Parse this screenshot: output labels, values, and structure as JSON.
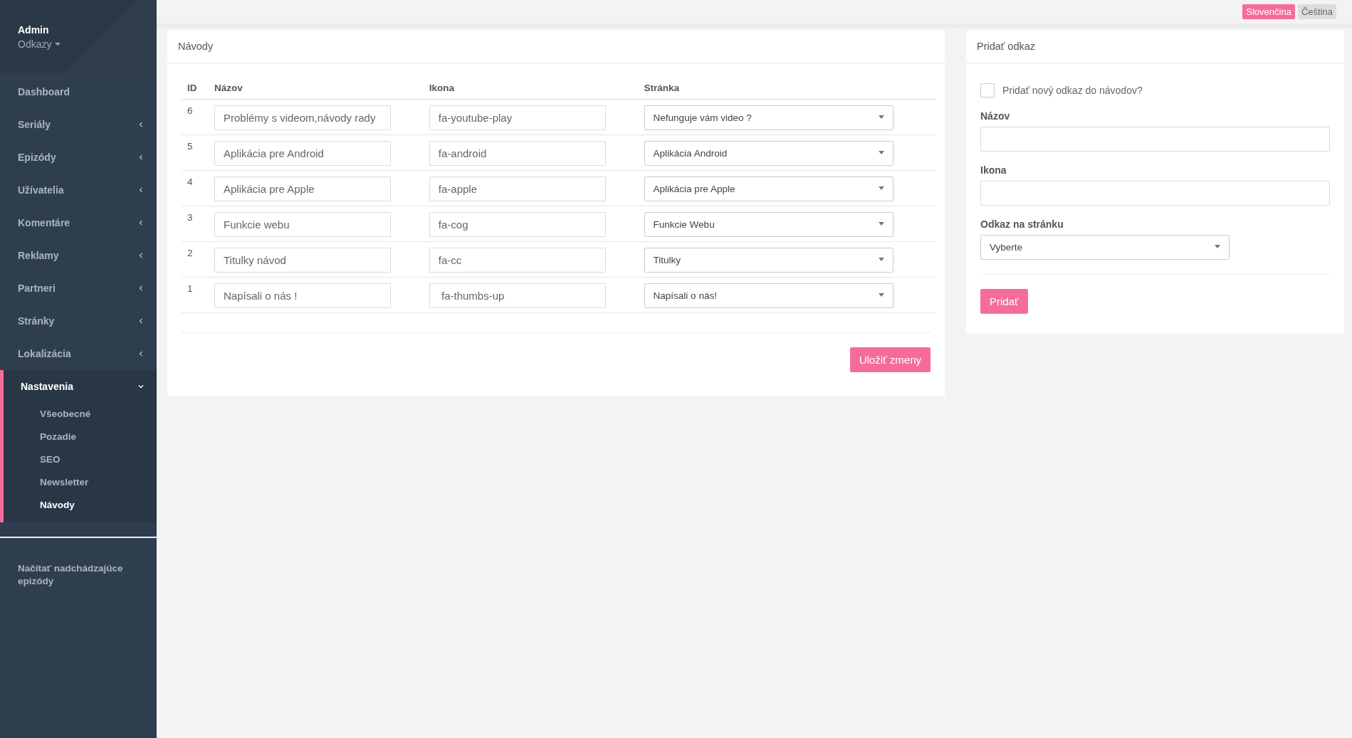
{
  "sidebar": {
    "user": "Admin",
    "subtitle": "Odkazy",
    "items": [
      {
        "label": "Dashboard",
        "kind": "link",
        "selected": false
      },
      {
        "label": "Seriály",
        "kind": "menu",
        "selected": false,
        "expanded": false
      },
      {
        "label": "Epizódy",
        "kind": "menu",
        "selected": false,
        "expanded": false
      },
      {
        "label": "Užívatelia",
        "kind": "menu",
        "selected": false,
        "expanded": false
      },
      {
        "label": "Komentáre",
        "kind": "menu",
        "selected": false,
        "expanded": false
      },
      {
        "label": "Reklamy",
        "kind": "menu",
        "selected": false,
        "expanded": false
      },
      {
        "label": "Partneri",
        "kind": "menu",
        "selected": false,
        "expanded": false
      },
      {
        "label": "Stránky",
        "kind": "menu",
        "selected": false,
        "expanded": false
      },
      {
        "label": "Lokalizácia",
        "kind": "menu",
        "selected": false,
        "expanded": false
      },
      {
        "label": "Nastavenia",
        "kind": "menu",
        "selected": true,
        "expanded": true,
        "children": [
          {
            "label": "Všeobecné",
            "selected": false
          },
          {
            "label": "Pozadie",
            "selected": false
          },
          {
            "label": "SEO",
            "selected": false
          },
          {
            "label": "Newsletter",
            "selected": false
          },
          {
            "label": "Návody",
            "selected": true
          }
        ]
      }
    ],
    "footer_link": "Načítať nadchádzajúce epizódy"
  },
  "languages": [
    {
      "label": "Slovenčina",
      "selected": true
    },
    {
      "label": "Čeština",
      "selected": false
    }
  ],
  "guides_panel": {
    "title": "Návody",
    "columns": [
      "ID",
      "Názov",
      "Ikona",
      "Stránka"
    ],
    "rows": [
      {
        "id": "6",
        "name": "Problémy s videom,návody rady",
        "icon": "fa-youtube-play",
        "page": "Nefunguje vám video ?"
      },
      {
        "id": "5",
        "name": "Aplikácia pre Android",
        "icon": "fa-android",
        "page": "Aplikácia Android"
      },
      {
        "id": "4",
        "name": "Aplikácia pre Apple",
        "icon": "fa-apple",
        "page": "Aplikácia pre Apple"
      },
      {
        "id": "3",
        "name": "Funkcie webu",
        "icon": "fa-cog",
        "page": "Funkcie Webu"
      },
      {
        "id": "2",
        "name": "Titulky návod",
        "icon": "fa-cc",
        "page": "Titulky"
      },
      {
        "id": "1",
        "name": "Napísali o nás !",
        "icon": " fa-thumbs-up",
        "page": "Napísali o nás!"
      }
    ],
    "save_button": "Uložiť zmeny"
  },
  "add_panel": {
    "title": "Pridať odkaz",
    "checkbox": {
      "label": "Pridať nový odkaz do návodov?",
      "checked": false
    },
    "name_label": "Názov",
    "icon_label": "Ikona",
    "page_label": "Odkaz na stránku",
    "page_select": "Vyberte",
    "submit_button": "Pridať"
  }
}
